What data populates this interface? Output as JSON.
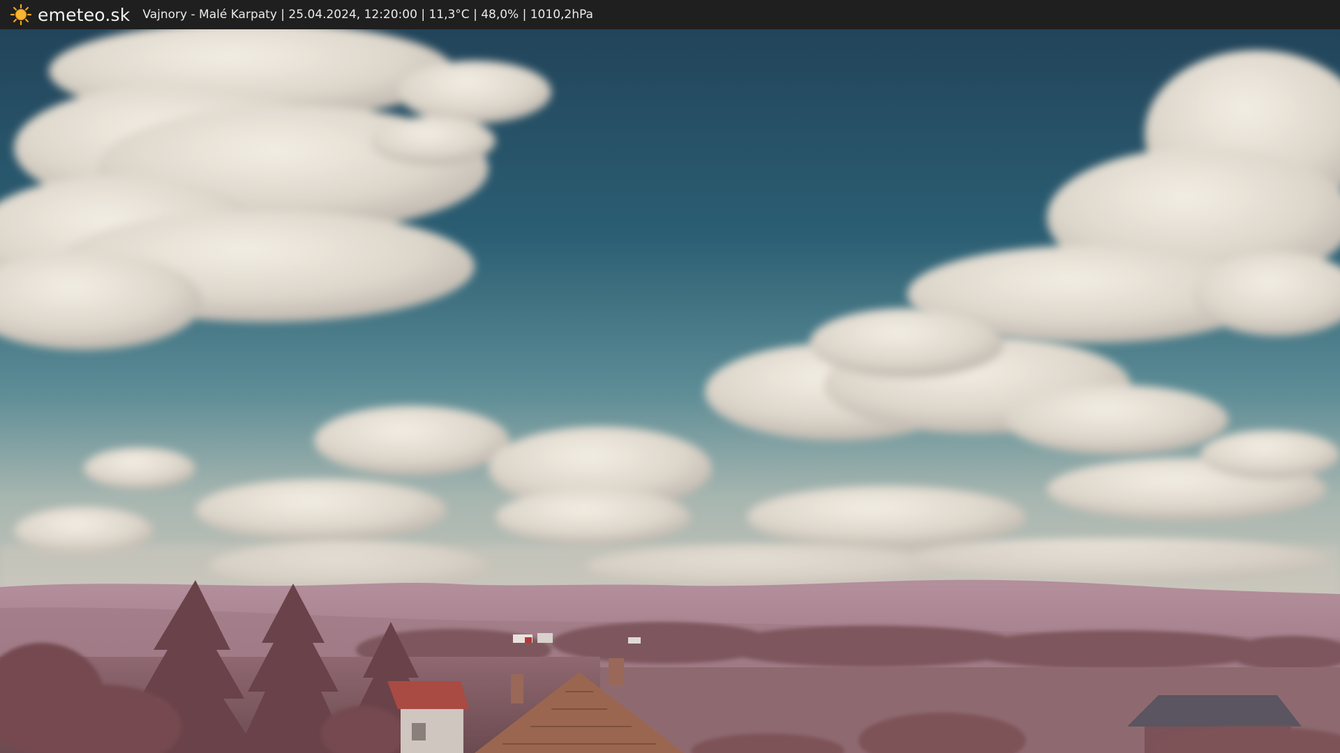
{
  "header": {
    "brand": "emeteo.sk",
    "logo_icon": "sun-icon",
    "caption": "Vajnory - Malé Karpaty | 25.04.2024, 12:20:00 | 11,3°C | 48,0% | 1010,2hPa"
  },
  "colors": {
    "bar": "#1f1f1f",
    "sky_top": "#24485e",
    "sky_mid": "#2f6478",
    "cloud": "#e6e0d6",
    "hills": "#a9848f",
    "foliage": "#8a5f66",
    "sun": "#f5a623"
  }
}
